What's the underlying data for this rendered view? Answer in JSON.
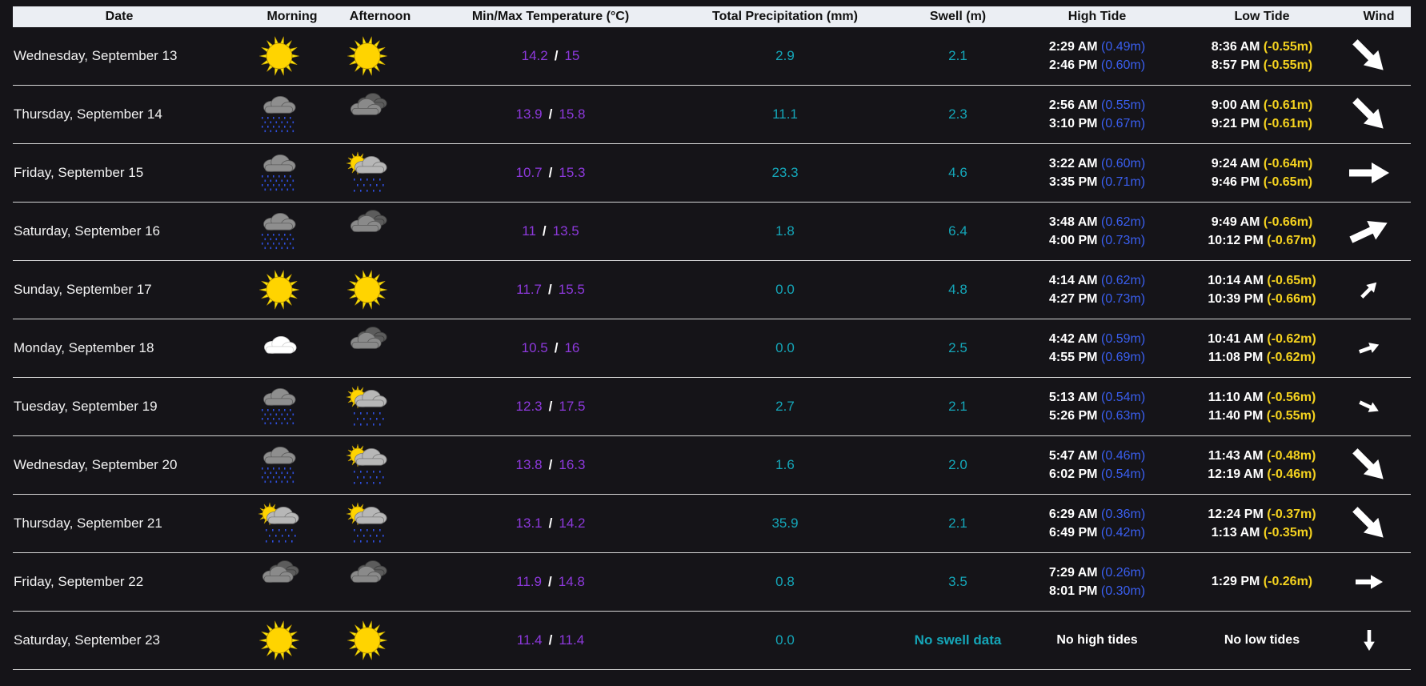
{
  "headers": {
    "date": "Date",
    "morning": "Morning",
    "afternoon": "Afternoon",
    "temperature": "Min/Max Temperature (°C)",
    "precipitation": "Total Precipitation (mm)",
    "swell": "Swell (m)",
    "high_tide": "High Tide",
    "low_tide": "Low Tide",
    "wind": "Wind"
  },
  "colors": {
    "background": "#151418",
    "temperature": "#8d39dc",
    "precipitation": "#15a6b8",
    "high_tide_height": "#3a5ff0",
    "low_tide_height": "#f4d21f"
  },
  "separator": "/",
  "days": [
    {
      "date": "Wednesday, September 13",
      "morning": "sun-icon",
      "afternoon": "sun-icon",
      "min": "14.2",
      "max": "15",
      "precip": "2.9",
      "swell": "2.1",
      "high": [
        {
          "time": "2:29 AM",
          "height": "(0.49m)"
        },
        {
          "time": "2:46 PM",
          "height": "(0.60m)"
        }
      ],
      "low": [
        {
          "time": "8:36 AM",
          "height": "(-0.55m)"
        },
        {
          "time": "8:57 PM",
          "height": "(-0.55m)"
        }
      ],
      "wind": {
        "direction_deg": 135,
        "strength": "large"
      }
    },
    {
      "date": "Thursday, September 14",
      "morning": "rain-cloud-icon",
      "afternoon": "dark-cloud-icon",
      "min": "13.9",
      "max": "15.8",
      "precip": "11.1",
      "swell": "2.3",
      "high": [
        {
          "time": "2:56 AM",
          "height": "(0.55m)"
        },
        {
          "time": "3:10 PM",
          "height": "(0.67m)"
        }
      ],
      "low": [
        {
          "time": "9:00 AM",
          "height": "(-0.61m)"
        },
        {
          "time": "9:21 PM",
          "height": "(-0.61m)"
        }
      ],
      "wind": {
        "direction_deg": 135,
        "strength": "large"
      }
    },
    {
      "date": "Friday, September 15",
      "morning": "rain-cloud-icon",
      "afternoon": "sun-cloud-rain-icon",
      "min": "10.7",
      "max": "15.3",
      "precip": "23.3",
      "swell": "4.6",
      "high": [
        {
          "time": "3:22 AM",
          "height": "(0.60m)"
        },
        {
          "time": "3:35 PM",
          "height": "(0.71m)"
        }
      ],
      "low": [
        {
          "time": "9:24 AM",
          "height": "(-0.64m)"
        },
        {
          "time": "9:46 PM",
          "height": "(-0.65m)"
        }
      ],
      "wind": {
        "direction_deg": 90,
        "strength": "large"
      }
    },
    {
      "date": "Saturday, September 16",
      "morning": "rain-cloud-icon",
      "afternoon": "dark-cloud-icon",
      "min": "11",
      "max": "13.5",
      "precip": "1.8",
      "swell": "6.4",
      "high": [
        {
          "time": "3:48 AM",
          "height": "(0.62m)"
        },
        {
          "time": "4:00 PM",
          "height": "(0.73m)"
        }
      ],
      "low": [
        {
          "time": "9:49 AM",
          "height": "(-0.66m)"
        },
        {
          "time": "10:12 PM",
          "height": "(-0.67m)"
        }
      ],
      "wind": {
        "direction_deg": 65,
        "strength": "large"
      }
    },
    {
      "date": "Sunday, September 17",
      "morning": "sun-icon",
      "afternoon": "sun-icon",
      "min": "11.7",
      "max": "15.5",
      "precip": "0.0",
      "swell": "4.8",
      "high": [
        {
          "time": "4:14 AM",
          "height": "(0.62m)"
        },
        {
          "time": "4:27 PM",
          "height": "(0.73m)"
        }
      ],
      "low": [
        {
          "time": "10:14 AM",
          "height": "(-0.65m)"
        },
        {
          "time": "10:39 PM",
          "height": "(-0.66m)"
        }
      ],
      "wind": {
        "direction_deg": 45,
        "strength": "small"
      }
    },
    {
      "date": "Monday, September 18",
      "morning": "white-cloud-icon",
      "afternoon": "dark-cloud-icon",
      "min": "10.5",
      "max": "16",
      "precip": "0.0",
      "swell": "2.5",
      "high": [
        {
          "time": "4:42 AM",
          "height": "(0.59m)"
        },
        {
          "time": "4:55 PM",
          "height": "(0.69m)"
        }
      ],
      "low": [
        {
          "time": "10:41 AM",
          "height": "(-0.62m)"
        },
        {
          "time": "11:08 PM",
          "height": "(-0.62m)"
        }
      ],
      "wind": {
        "direction_deg": 70,
        "strength": "small"
      }
    },
    {
      "date": "Tuesday, September 19",
      "morning": "rain-cloud-icon",
      "afternoon": "sun-cloud-rain-icon",
      "min": "12.3",
      "max": "17.5",
      "precip": "2.7",
      "swell": "2.1",
      "high": [
        {
          "time": "5:13 AM",
          "height": "(0.54m)"
        },
        {
          "time": "5:26 PM",
          "height": "(0.63m)"
        }
      ],
      "low": [
        {
          "time": "11:10 AM",
          "height": "(-0.56m)"
        },
        {
          "time": "11:40 PM",
          "height": "(-0.55m)"
        }
      ],
      "wind": {
        "direction_deg": 115,
        "strength": "small"
      }
    },
    {
      "date": "Wednesday, September 20",
      "morning": "rain-cloud-icon",
      "afternoon": "sun-cloud-rain-icon",
      "min": "13.8",
      "max": "16.3",
      "precip": "1.6",
      "swell": "2.0",
      "high": [
        {
          "time": "5:47 AM",
          "height": "(0.46m)"
        },
        {
          "time": "6:02 PM",
          "height": "(0.54m)"
        }
      ],
      "low": [
        {
          "time": "11:43 AM",
          "height": "(-0.48m)"
        },
        {
          "time": "12:19 AM",
          "height": "(-0.46m)"
        }
      ],
      "wind": {
        "direction_deg": 135,
        "strength": "large"
      }
    },
    {
      "date": "Thursday, September 21",
      "morning": "sun-cloud-rain-icon",
      "afternoon": "sun-cloud-rain-icon",
      "min": "13.1",
      "max": "14.2",
      "precip": "35.9",
      "swell": "2.1",
      "high": [
        {
          "time": "6:29 AM",
          "height": "(0.36m)"
        },
        {
          "time": "6:49 PM",
          "height": "(0.42m)"
        }
      ],
      "low": [
        {
          "time": "12:24 PM",
          "height": "(-0.37m)"
        },
        {
          "time": "1:13 AM",
          "height": "(-0.35m)"
        }
      ],
      "wind": {
        "direction_deg": 135,
        "strength": "large"
      }
    },
    {
      "date": "Friday, September 22",
      "morning": "dark-cloud-icon",
      "afternoon": "dark-cloud-icon",
      "min": "11.9",
      "max": "14.8",
      "precip": "0.8",
      "swell": "3.5",
      "high": [
        {
          "time": "7:29 AM",
          "height": "(0.26m)"
        },
        {
          "time": "8:01 PM",
          "height": "(0.30m)"
        }
      ],
      "low": [
        {
          "time": "1:29 PM",
          "height": "(-0.26m)"
        }
      ],
      "wind": {
        "direction_deg": 90,
        "strength": "medium"
      }
    },
    {
      "date": "Saturday, September 23",
      "morning": "sun-icon",
      "afternoon": "sun-icon",
      "min": "11.4",
      "max": "11.4",
      "precip": "0.0",
      "swell": "No swell data",
      "high_text": "No high tides",
      "low_text": "No low tides",
      "wind": {
        "direction_deg": 180,
        "strength": "small"
      }
    }
  ]
}
